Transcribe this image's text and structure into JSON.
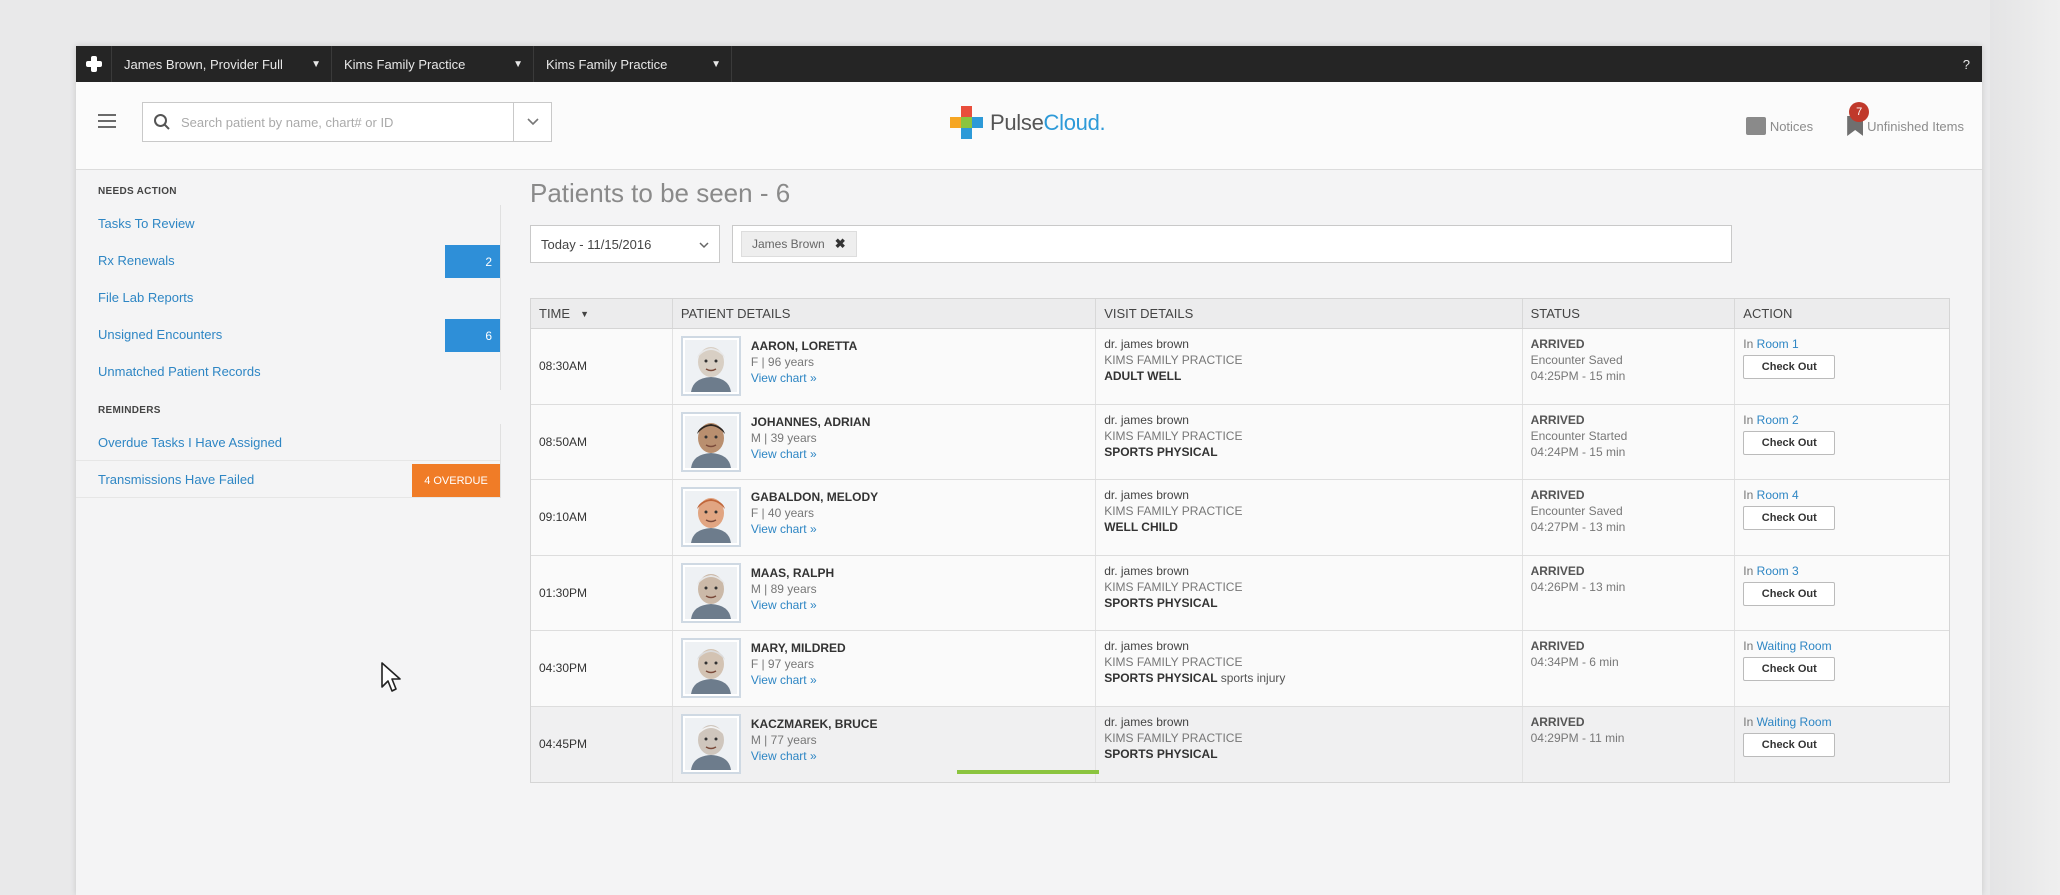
{
  "topbar": {
    "user": "James Brown, Provider Full",
    "practice1": "Kims Family Practice",
    "practice2": "Kims Family Practice",
    "help": "?"
  },
  "header": {
    "search_placeholder": "Search patient by name, chart# or ID",
    "logo_part1": "Pulse",
    "logo_part2": "Cloud.",
    "notices": "Notices",
    "unfinished": "Unfinished Items",
    "unfinished_count": "7"
  },
  "sidebar": {
    "needs_action_title": "NEEDS ACTION",
    "needs_action": [
      {
        "label": "Tasks To Review",
        "count": ""
      },
      {
        "label": "Rx Renewals",
        "count": "2"
      },
      {
        "label": "File Lab Reports",
        "count": ""
      },
      {
        "label": "Unsigned Encounters",
        "count": "6"
      },
      {
        "label": "Unmatched Patient Records",
        "count": ""
      }
    ],
    "reminders_title": "REMINDERS",
    "reminders": [
      {
        "label": "Overdue Tasks I Have Assigned",
        "badge": ""
      },
      {
        "label": "Transmissions Have Failed",
        "badge": "4 OVERDUE"
      }
    ]
  },
  "main": {
    "title": "Patients to be seen - 6",
    "date_filter": "Today - 11/15/2016",
    "chip": "James Brown",
    "columns": {
      "time": "TIME",
      "patient": "PATIENT DETAILS",
      "visit": "VISIT DETAILS",
      "status": "STATUS",
      "action": "ACTION"
    },
    "view_chart": "View chart »",
    "checkout_label": "Check Out",
    "rows": [
      {
        "time": "08:30AM",
        "name": "AARON, LORETTA",
        "info": "F | 96 years",
        "doctor": "dr. james brown",
        "practice": "KIMS FAMILY PRACTICE",
        "visit_type": "ADULT WELL",
        "visit_note": "",
        "status": "ARRIVED",
        "status_detail": "Encounter Saved",
        "status_time": "04:25PM - 15 min",
        "room_prefix": "In",
        "room": "Room 1"
      },
      {
        "time": "08:50AM",
        "name": "JOHANNES, ADRIAN",
        "info": "M | 39 years",
        "doctor": "dr. james brown",
        "practice": "KIMS FAMILY PRACTICE",
        "visit_type": "SPORTS PHYSICAL",
        "visit_note": "",
        "status": "ARRIVED",
        "status_detail": "Encounter Started",
        "status_time": "04:24PM - 15 min",
        "room_prefix": "In",
        "room": "Room 2"
      },
      {
        "time": "09:10AM",
        "name": "GABALDON, MELODY",
        "info": "F | 40 years",
        "doctor": "dr. james brown",
        "practice": "KIMS FAMILY PRACTICE",
        "visit_type": "WELL CHILD",
        "visit_note": "",
        "status": "ARRIVED",
        "status_detail": "Encounter Saved",
        "status_time": "04:27PM - 13 min",
        "room_prefix": "In",
        "room": "Room 4"
      },
      {
        "time": "01:30PM",
        "name": "MAAS, RALPH",
        "info": "M | 89 years",
        "doctor": "dr. james brown",
        "practice": "KIMS FAMILY PRACTICE",
        "visit_type": "SPORTS PHYSICAL",
        "visit_note": "",
        "status": "ARRIVED",
        "status_detail": "04:26PM - 13 min",
        "status_time": "",
        "room_prefix": "In",
        "room": "Room 3"
      },
      {
        "time": "04:30PM",
        "name": "MARY, MILDRED",
        "info": "F | 97 years",
        "doctor": "dr. james brown",
        "practice": "KIMS FAMILY PRACTICE",
        "visit_type": "SPORTS PHYSICAL",
        "visit_note": "sports injury",
        "status": "ARRIVED",
        "status_detail": "04:34PM - 6 min",
        "status_time": "",
        "room_prefix": "In",
        "room": "Waiting Room"
      },
      {
        "time": "04:45PM",
        "name": "KACZMAREK, BRUCE",
        "info": "M | 77 years",
        "doctor": "dr. james brown",
        "practice": "KIMS FAMILY PRACTICE",
        "visit_type": "SPORTS PHYSICAL",
        "visit_note": "",
        "status": "ARRIVED",
        "status_detail": "04:29PM - 11 min",
        "status_time": "",
        "room_prefix": "In",
        "room": "Waiting Room"
      }
    ]
  },
  "colors": {
    "link": "#2e86c4",
    "count_badge": "#2e8fd8",
    "overdue_badge": "#f07c27",
    "topbar": "#252525",
    "progress": "#8bc43f"
  }
}
